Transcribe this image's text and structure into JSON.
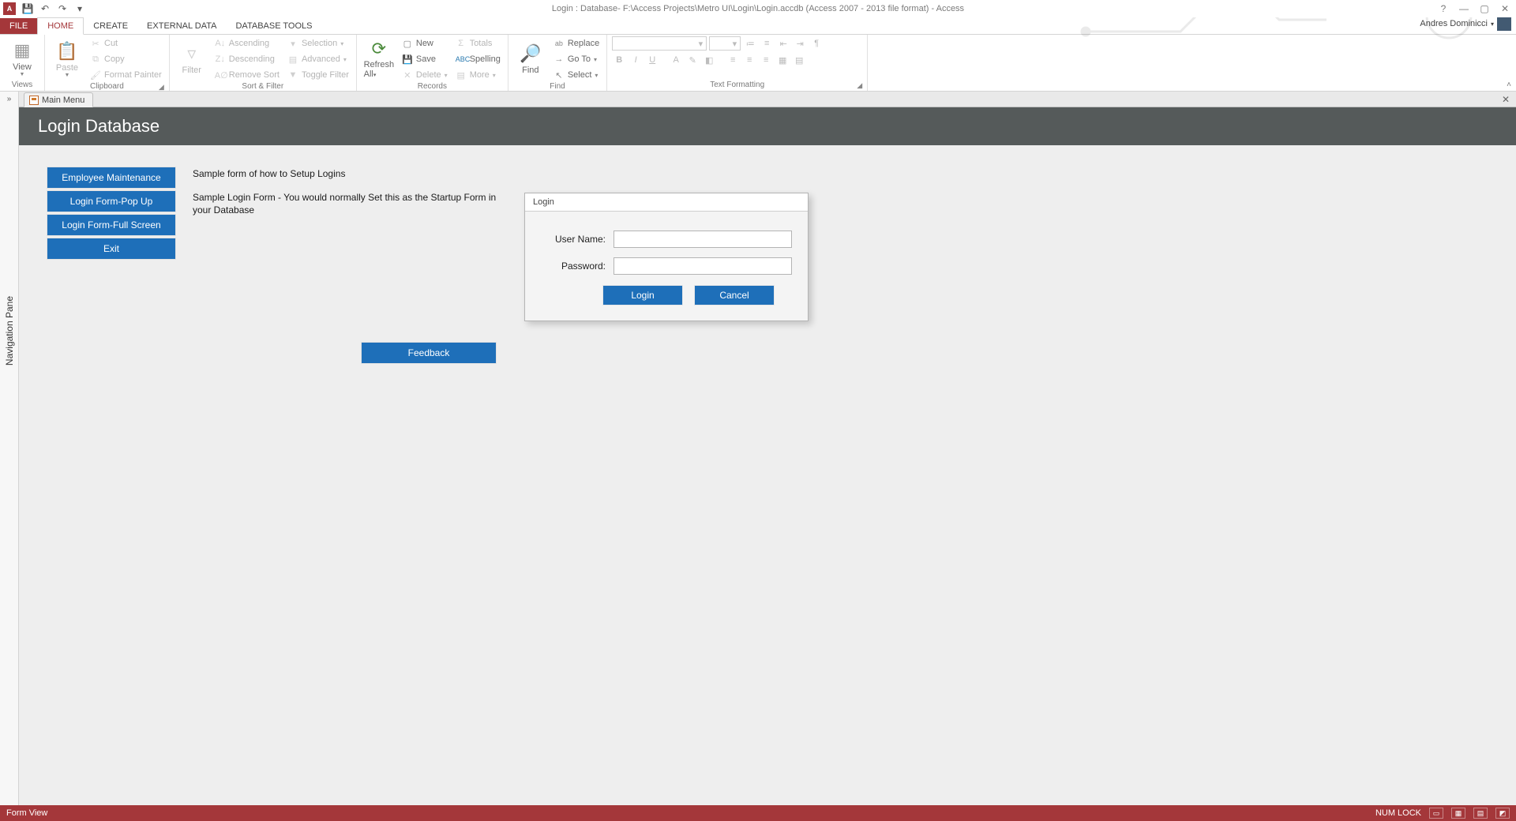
{
  "titlebar": {
    "title": "Login : Database- F:\\Access Projects\\Metro UI\\Login\\Login.accdb (Access 2007 - 2013 file format) - Access",
    "user": "Andres Dominicci"
  },
  "tabs": {
    "file": "FILE",
    "home": "HOME",
    "create": "CREATE",
    "external": "EXTERNAL DATA",
    "dbtools": "DATABASE TOOLS"
  },
  "ribbon": {
    "views": {
      "view": "View",
      "group": "Views"
    },
    "clipboard": {
      "paste": "Paste",
      "cut": "Cut",
      "copy": "Copy",
      "format_painter": "Format Painter",
      "group": "Clipboard"
    },
    "sort": {
      "filter": "Filter",
      "asc": "Ascending",
      "desc": "Descending",
      "remove": "Remove Sort",
      "selection": "Selection",
      "advanced": "Advanced",
      "toggle": "Toggle Filter",
      "group": "Sort & Filter"
    },
    "records": {
      "refresh": "Refresh All",
      "new": "New",
      "save": "Save",
      "delete": "Delete",
      "totals": "Totals",
      "spelling": "Spelling",
      "more": "More",
      "group": "Records"
    },
    "find": {
      "find": "Find",
      "replace": "Replace",
      "goto": "Go To",
      "select": "Select",
      "group": "Find"
    },
    "text": {
      "group": "Text Formatting"
    }
  },
  "navpane": {
    "label": "Navigation Pane"
  },
  "doc_tab": {
    "label": "Main Menu"
  },
  "form": {
    "title": "Login Database",
    "buttons": {
      "emp": "Employee Maintenance",
      "popup": "Login Form-Pop Up",
      "full": "Login Form-Full Screen",
      "exit": "Exit",
      "feedback": "Feedback"
    },
    "desc1": "Sample form of how to Setup Logins",
    "desc2": "Sample Login Form - You would normally Set this as the Startup Form in your Database",
    "dialog": {
      "title": "Login",
      "username_label": "User Name:",
      "password_label": "Password:",
      "login": "Login",
      "cancel": "Cancel"
    }
  },
  "statusbar": {
    "left": "Form View",
    "numlock": "NUM LOCK"
  }
}
